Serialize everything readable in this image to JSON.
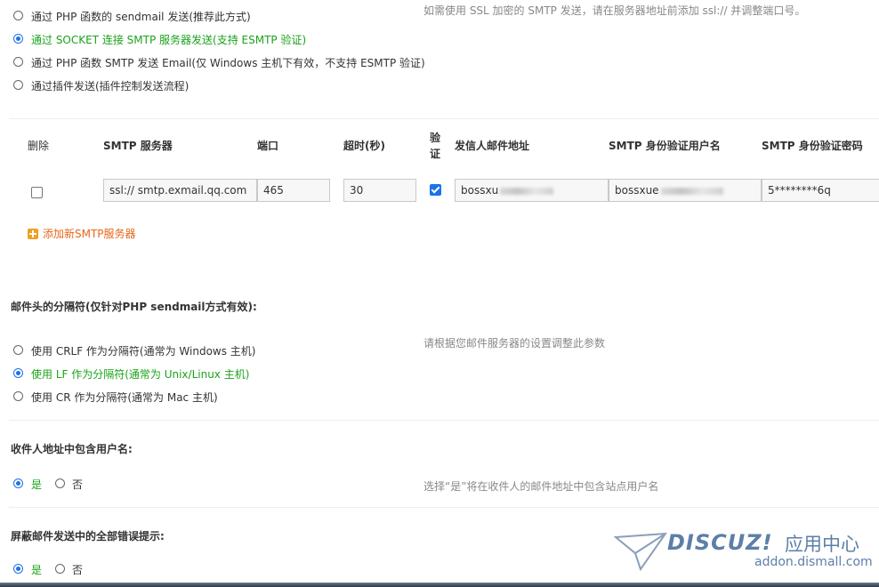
{
  "send_mode": {
    "options": [
      {
        "label": "通过 PHP 函数的 sendmail 发送(推荐此方式)",
        "selected": false
      },
      {
        "label": "通过 SOCKET 连接 SMTP 服务器发送(支持 ESMTP 验证)",
        "selected": true
      },
      {
        "label": "通过 PHP 函数 SMTP 发送 Email(仅 Windows 主机下有效，不支持 ESMTP 验证)",
        "selected": false
      },
      {
        "label": "通过插件发送(插件控制发送流程)",
        "selected": false
      }
    ],
    "hint": "如需使用 SSL 加密的 SMTP 发送，请在服务器地址前添加 ssl:// 并调整端口号。"
  },
  "smtp_table": {
    "headers": {
      "delete": "删除",
      "server": "SMTP 服务器",
      "port": "端口",
      "timeout": "超时(秒)",
      "auth": "验证",
      "from": "发信人邮件地址",
      "auth_user": "SMTP 身份验证用户名",
      "auth_pass": "SMTP 身份验证密码"
    },
    "rows": [
      {
        "delete": false,
        "server": "ssl:// smtp.exmail.qq.com",
        "port": "465",
        "timeout": "30",
        "auth": true,
        "from": "bossxu",
        "auth_user": "bossxue",
        "auth_pass": "5********6q"
      }
    ],
    "add_label": "添加新SMTP服务器"
  },
  "separator": {
    "title": "邮件头的分隔符(仅针对PHP sendmail方式有效):",
    "options": [
      {
        "label": "使用 CRLF 作为分隔符(通常为 Windows 主机)",
        "selected": false
      },
      {
        "label": "使用 LF 作为分隔符(通常为 Unix/Linux 主机)",
        "selected": true
      },
      {
        "label": "使用 CR 作为分隔符(通常为 Mac 主机)",
        "selected": false
      }
    ],
    "hint": "请根据您邮件服务器的设置调整此参数"
  },
  "include_username": {
    "title": "收件人地址中包含用户名:",
    "yes": "是",
    "no": "否",
    "value": "yes",
    "hint": "选择“是”将在收件人的邮件地址中包含站点用户名"
  },
  "silent_errors": {
    "title": "屏蔽邮件发送中的全部错误提示:",
    "yes": "是",
    "no": "否",
    "value": "yes"
  },
  "watermark": {
    "brand": "DISCUZ!",
    "cn": "应用中心",
    "url": "addon.dismall.com"
  },
  "colors": {
    "accent": "#1a73e8",
    "selected_text": "#1aa31a",
    "add_link": "#e8661a",
    "hint": "#888888"
  }
}
